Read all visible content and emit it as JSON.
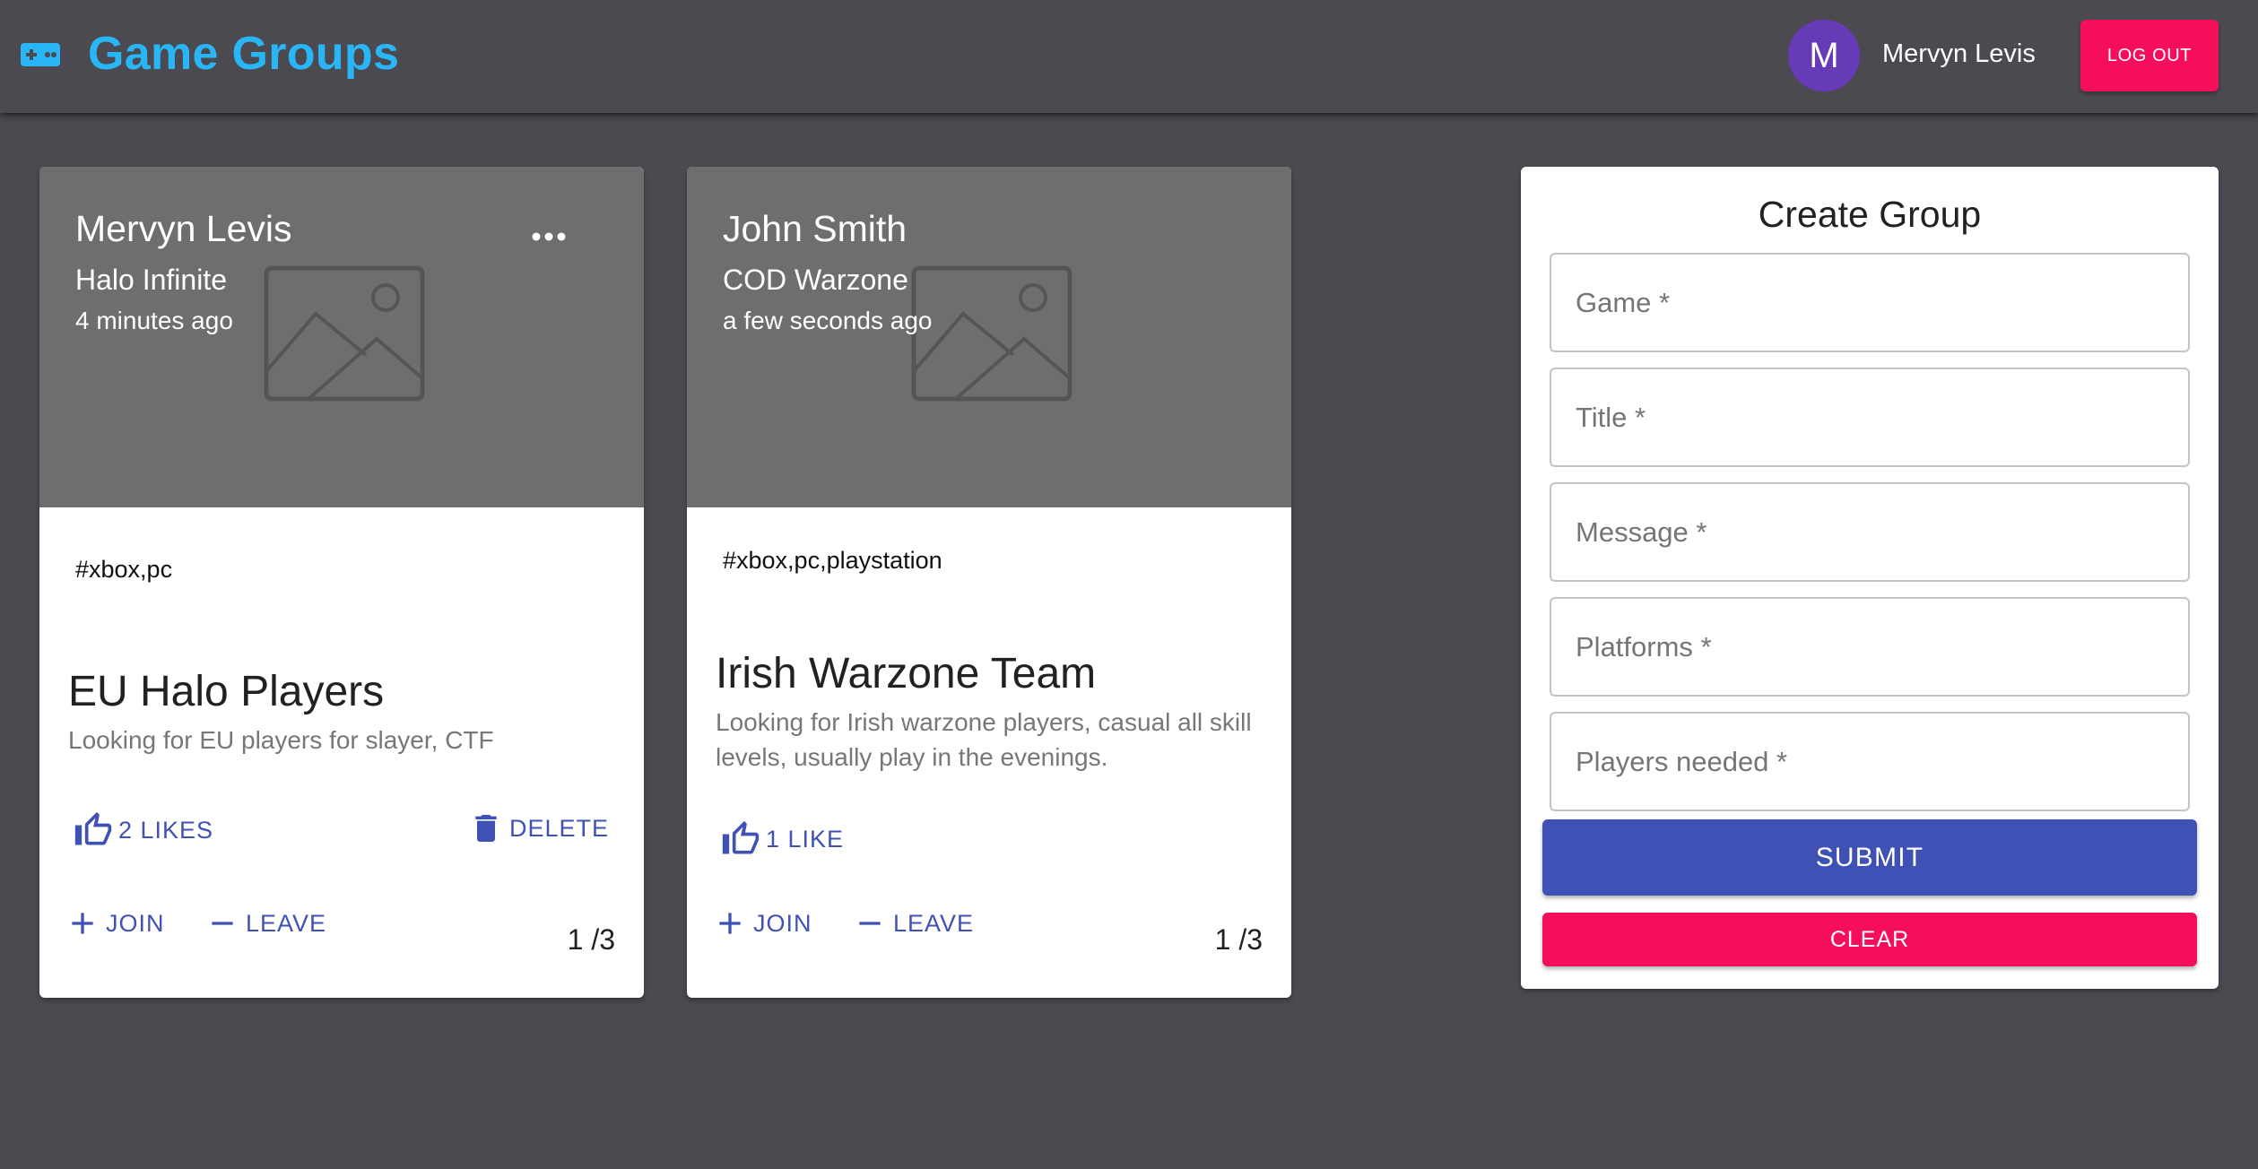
{
  "header": {
    "icon": "gamepad-icon",
    "title": "Game Groups",
    "avatar_initial": "M",
    "user_name": "Mervyn Levis",
    "logout_label": "LOG OUT"
  },
  "groups": [
    {
      "author": "Mervyn Levis",
      "game": "Halo Infinite",
      "time_ago": "4 minutes ago",
      "tags": "#xbox,pc",
      "title": "EU Halo Players",
      "message": "Looking for EU players for slayer, CTF",
      "likes_label": "2 LIKES",
      "delete_label": "DELETE",
      "join_label": "JOIN",
      "leave_label": "LEAVE",
      "players_count": "1 /3",
      "show_more_menu": true
    },
    {
      "author": "John Smith",
      "game": "COD Warzone",
      "time_ago": "a few seconds ago",
      "tags": "#xbox,pc,playstation",
      "title": "Irish Warzone Team",
      "message": "Looking for Irish warzone players, casual all skill levels, usually play in the evenings.",
      "likes_label": "1 LIKE",
      "join_label": "JOIN",
      "leave_label": "LEAVE",
      "players_count": "1 /3",
      "show_more_menu": false
    }
  ],
  "form": {
    "title": "Create Group",
    "fields": [
      {
        "placeholder": "Game *",
        "value": ""
      },
      {
        "placeholder": "Title *",
        "value": ""
      },
      {
        "placeholder": "Message *",
        "value": ""
      },
      {
        "placeholder": "Platforms *",
        "value": ""
      },
      {
        "placeholder": "Players needed *",
        "value": ""
      }
    ],
    "submit_label": "SUBMIT",
    "clear_label": "CLEAR"
  },
  "colors": {
    "background": "#4a4a50",
    "brand": "#29b6f6",
    "primary": "#3f51b5",
    "secondary": "#f50f5a",
    "avatar": "#673ab7",
    "card_media": "#6e6e6e"
  },
  "icons": {
    "more": "more-horiz-icon",
    "like": "thumb-up-icon",
    "delete": "trash-icon",
    "join": "plus-icon",
    "leave": "minus-icon",
    "media": "image-placeholder-icon"
  }
}
